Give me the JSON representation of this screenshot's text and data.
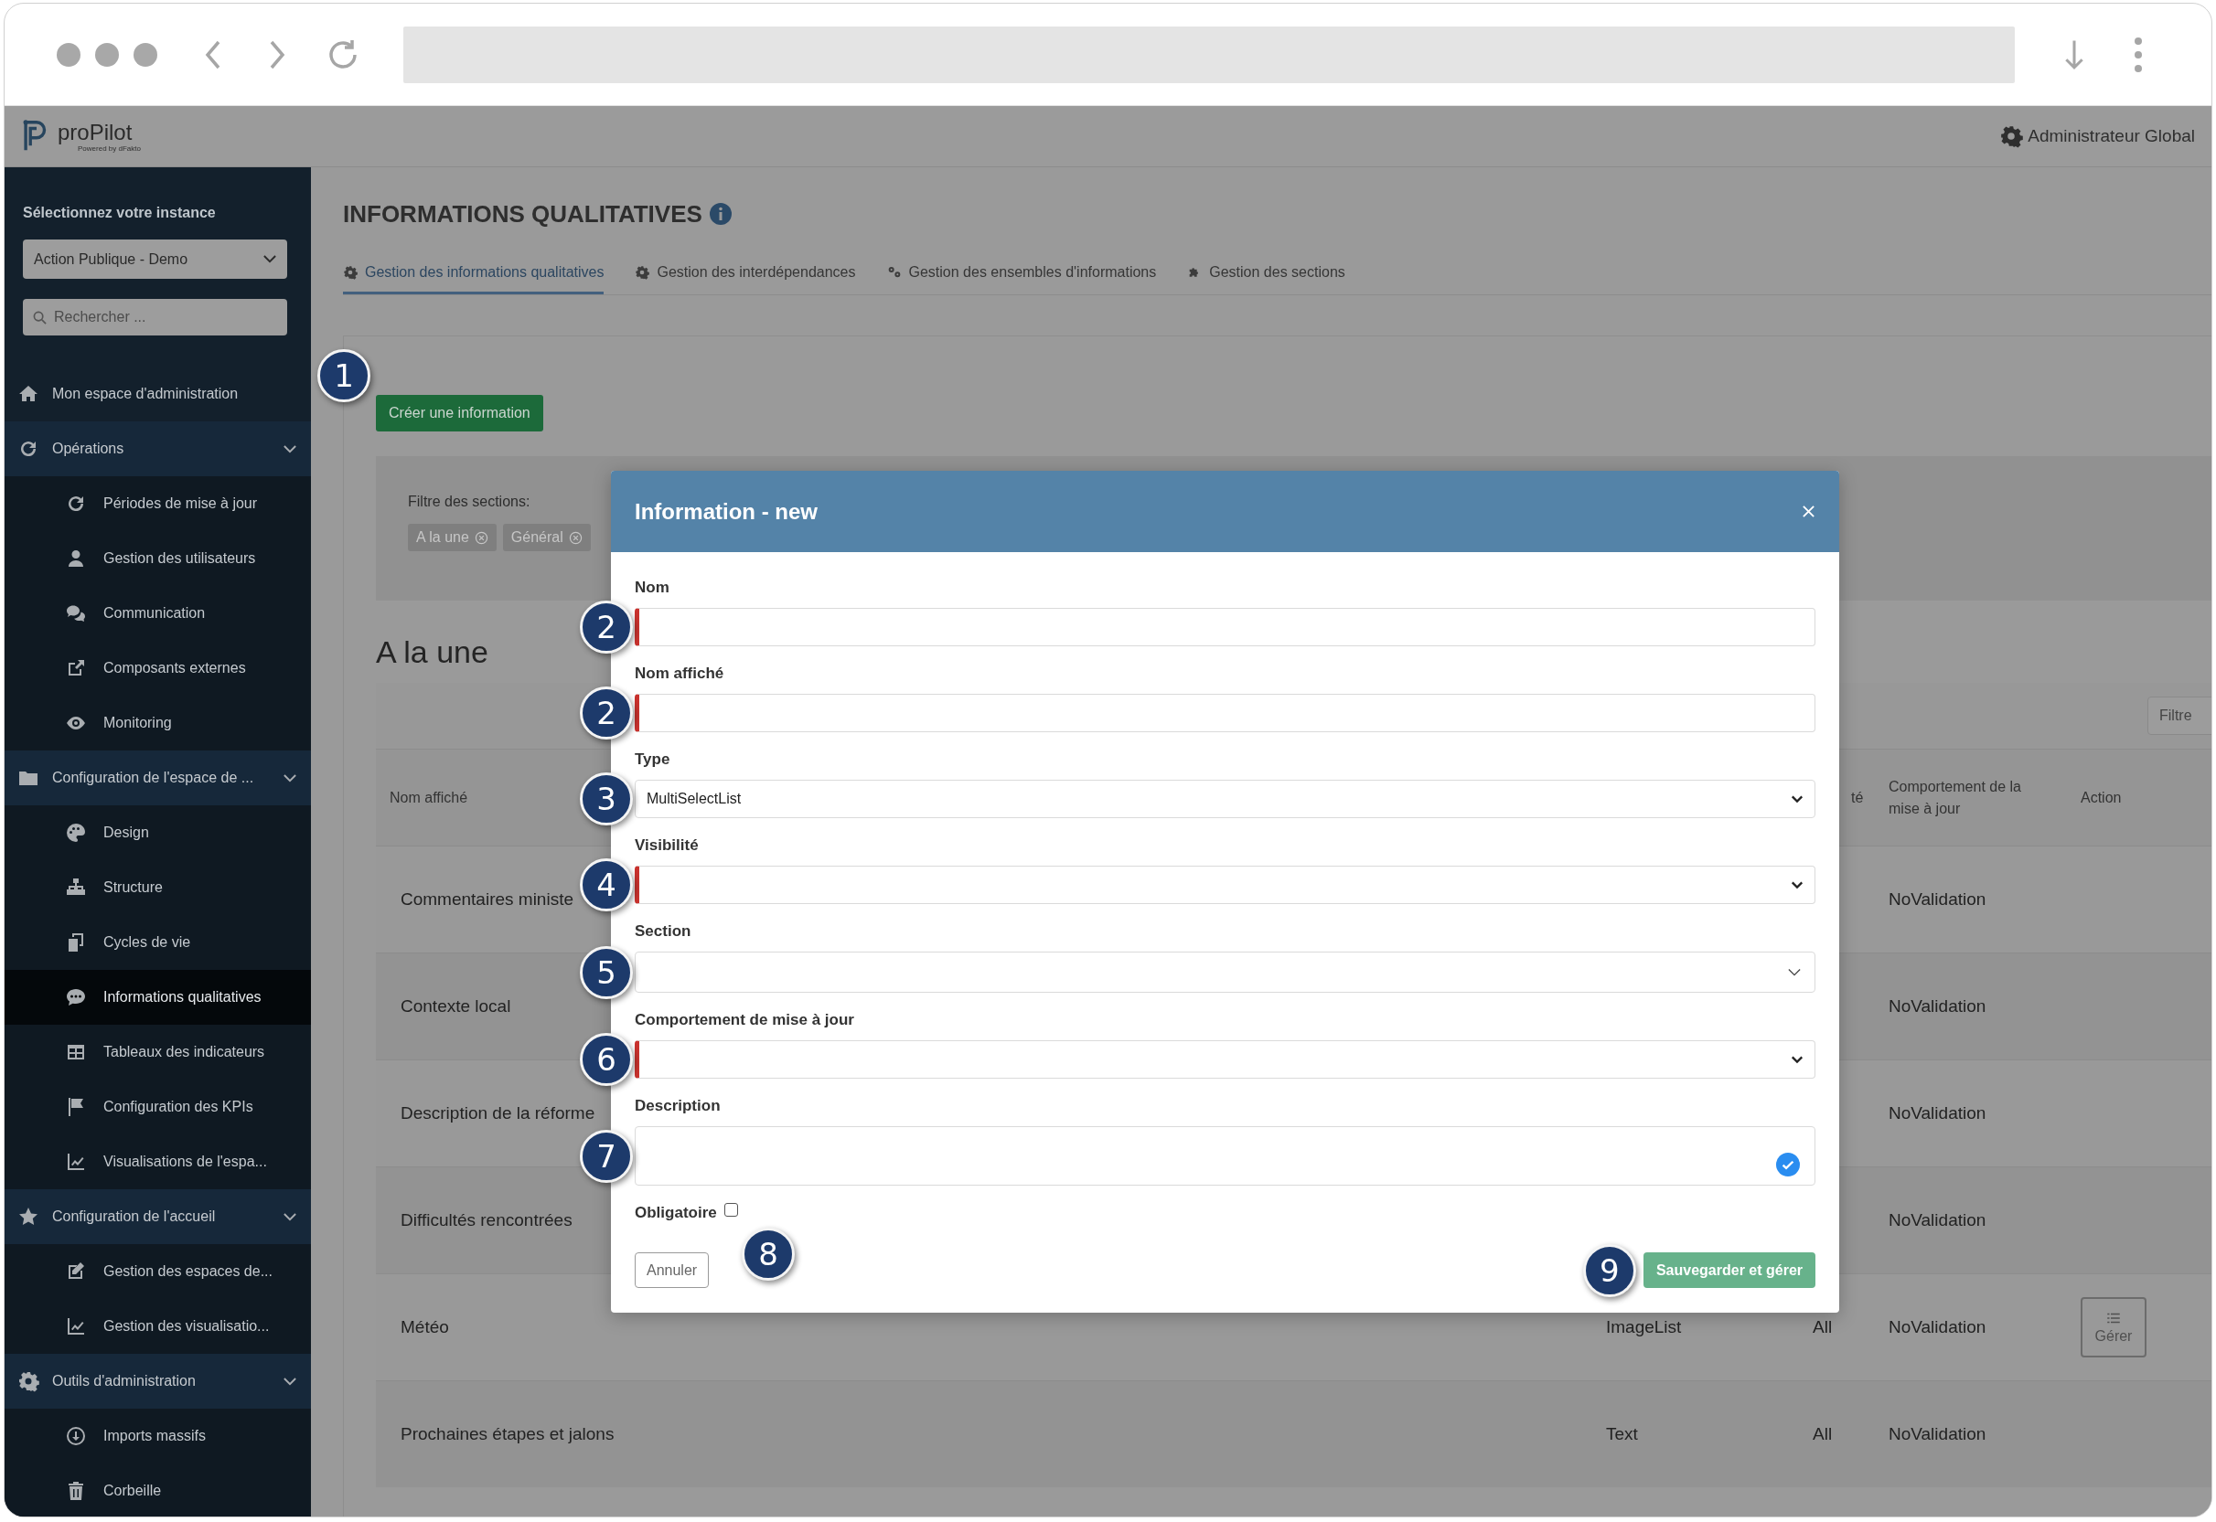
{
  "app": {
    "logo_text": "proPilot",
    "logo_subtext": "Powered by dFakto",
    "user": "Administrateur Global"
  },
  "sidebar": {
    "instance_label": "Sélectionnez votre instance",
    "instance_value": "Action Publique - Demo",
    "search_placeholder": "Rechercher ...",
    "items": [
      {
        "label": "Mon espace d'administration",
        "selected": false
      },
      {
        "label": "Opérations",
        "selected": false,
        "expanded": true,
        "children": [
          {
            "label": "Périodes de mise à jour",
            "selected": false
          },
          {
            "label": "Gestion des utilisateurs",
            "selected": false
          },
          {
            "label": "Communication",
            "selected": false
          },
          {
            "label": "Composants externes",
            "selected": false
          },
          {
            "label": "Monitoring",
            "selected": false
          }
        ]
      },
      {
        "label": "Configuration de l'espace de ...",
        "selected": false,
        "expanded": true,
        "children": [
          {
            "label": "Design",
            "selected": false
          },
          {
            "label": "Structure",
            "selected": false
          },
          {
            "label": "Cycles de vie",
            "selected": false
          },
          {
            "label": "Informations qualitatives",
            "selected": true
          },
          {
            "label": "Tableaux des indicateurs",
            "selected": false
          },
          {
            "label": "Configuration des KPIs",
            "selected": false
          },
          {
            "label": "Visualisations de l'espa...",
            "selected": false
          }
        ]
      },
      {
        "label": "Configuration de l'accueil",
        "selected": false,
        "expanded": true,
        "children": [
          {
            "label": "Gestion des espaces de...",
            "selected": false
          },
          {
            "label": "Gestion des visualisatio...",
            "selected": false
          }
        ]
      },
      {
        "label": "Outils d'administration",
        "selected": false,
        "expanded": true,
        "children": [
          {
            "label": "Imports massifs",
            "selected": false
          },
          {
            "label": "Corbeille",
            "selected": false
          }
        ]
      }
    ]
  },
  "page": {
    "title": "INFORMATIONS QUALITATIVES",
    "tabs": [
      {
        "label": "Gestion des informations qualitatives",
        "selected": true
      },
      {
        "label": "Gestion des interdépendances",
        "selected": false
      },
      {
        "label": "Gestion des ensembles d'informations",
        "selected": false
      },
      {
        "label": "Gestion des sections",
        "selected": false
      }
    ],
    "create_button": {
      "label": "Créer une information",
      "callout": "1"
    },
    "filter_label": "Filtre des sections:",
    "filter_tags": [
      "A la une",
      "Général"
    ],
    "section_title": "A la une",
    "table_filter_placeholder": "Filtre",
    "table": {
      "columns": [
        "Nom affiché",
        "té",
        "Comportement de la mise à jour",
        "Action"
      ],
      "rows": [
        {
          "name": "Commentaires ministe",
          "behaviour": "NoValidation"
        },
        {
          "name": "Contexte local",
          "behaviour": "NoValidation"
        },
        {
          "name": "Description de la réforme",
          "behaviour": "NoValidation"
        },
        {
          "name": "Difficultés rencontrées",
          "behaviour": "NoValidation"
        },
        {
          "name": "Météo",
          "type": "ImageList",
          "visibility": "All",
          "behaviour": "NoValidation",
          "action": "Gérer"
        },
        {
          "name": "Prochaines étapes et jalons",
          "type": "Text",
          "visibility": "All",
          "behaviour": "NoValidation"
        }
      ]
    }
  },
  "modal": {
    "title": "Information - new",
    "fields": [
      {
        "label": "Nom",
        "kind": "text",
        "invalid": true,
        "callout": "2"
      },
      {
        "label": "Nom affiché",
        "kind": "text",
        "invalid": true,
        "callout": "2"
      },
      {
        "label": "Type",
        "kind": "select",
        "value": "MultiSelectList",
        "invalid": false,
        "callout": "3"
      },
      {
        "label": "Visibilité",
        "kind": "select",
        "invalid": true,
        "callout": "4"
      },
      {
        "label": "Section",
        "kind": "multiselect",
        "invalid": false,
        "callout": "5"
      },
      {
        "label": "Comportement de mise à jour",
        "kind": "select",
        "invalid": true,
        "callout": "6"
      },
      {
        "label": "Description",
        "kind": "textarea",
        "invalid": false,
        "callout": "7"
      }
    ],
    "required": {
      "label": "Obligatoire",
      "checked": false,
      "callout": "8"
    },
    "cancel": "Annuler",
    "save": {
      "label": "Sauvegarder et gérer",
      "callout": "9"
    }
  }
}
